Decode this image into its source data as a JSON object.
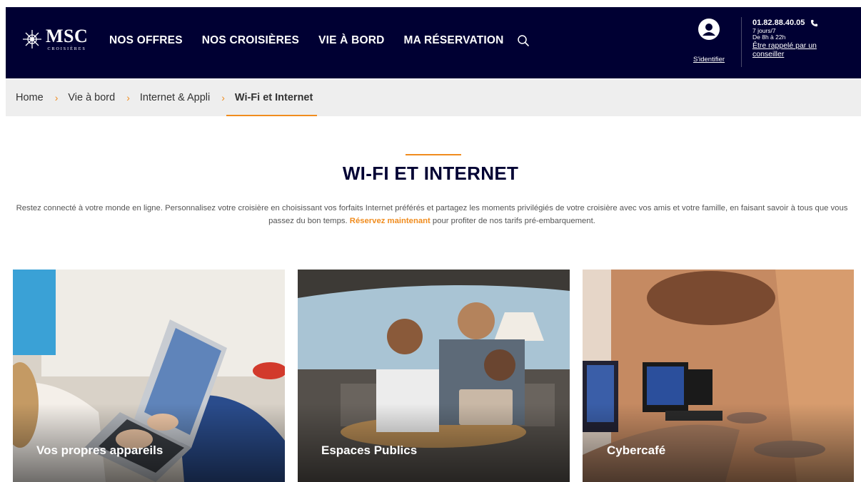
{
  "header": {
    "logo_text": "MSC",
    "logo_subtext": "CROISIÈRES",
    "nav": [
      "NOS OFFRES",
      "NOS CROISIÈRES",
      "VIE À BORD",
      "MA RÉSERVATION"
    ],
    "account_label": "S'identifier",
    "phone": "01.82.88.40.05",
    "hours_line1": "7 jours/7",
    "hours_line2": "De 8h à 22h",
    "callback_link": "Être rappelé par un conseiller"
  },
  "breadcrumb": {
    "items": [
      "Home",
      "Vie à bord",
      "Internet & Appli"
    ],
    "separator": "›",
    "current": "Wi-Fi et Internet"
  },
  "main": {
    "title": "WI-FI ET INTERNET",
    "intro_before": "Restez connecté à votre monde en ligne. Personnalisez votre croisière en choisissant vos forfaits Internet préférés et partagez les moments privilégiés de votre croisière avec vos amis et votre famille, en faisant savoir à tous que vous passez du bon temps. ",
    "intro_link": "Réservez maintenant",
    "intro_after": " pour profiter de nos tarifs pré-embarquement."
  },
  "cards": [
    {
      "label": "Vos propres appareils"
    },
    {
      "label": "Espaces Publics"
    },
    {
      "label": "Cybercafé"
    }
  ],
  "colors": {
    "navy": "#000033",
    "accent": "#f08c1e",
    "breadcrumb_bg": "#eeeeee"
  },
  "icons": {
    "search": "search-icon",
    "account": "user-icon",
    "phone": "phone-icon",
    "breadcrumb_separator": "chevron-right-icon"
  }
}
